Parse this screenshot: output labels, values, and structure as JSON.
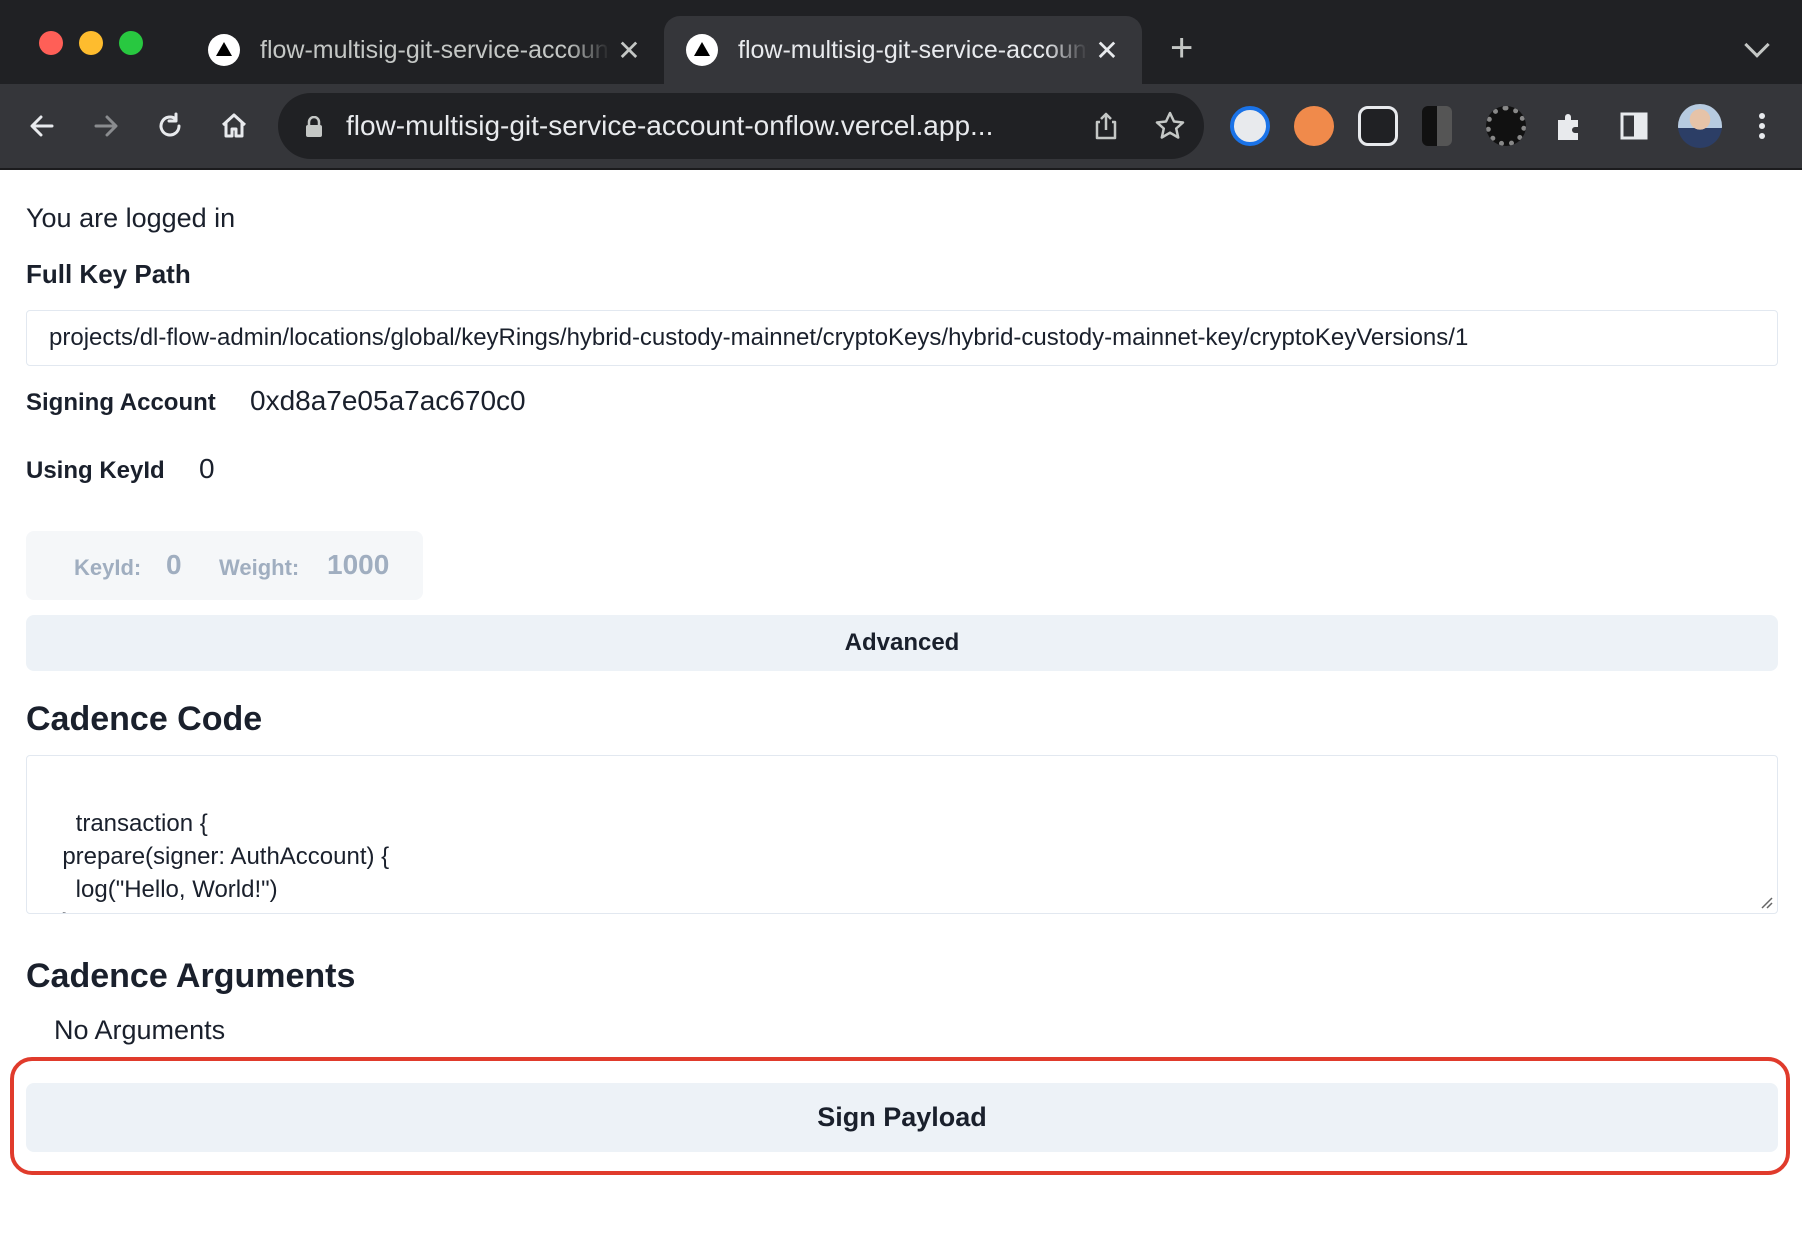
{
  "browser": {
    "tabs": [
      {
        "title": "flow-multisig-git-service-account-onflow",
        "active": false
      },
      {
        "title": "flow-multisig-git-service-account-onflow",
        "active": true
      }
    ],
    "new_tab_icon": "plus-icon",
    "url": "flow-multisig-git-service-account-onflow.vercel.app...",
    "extensions": [
      "password-manager-icon",
      "incognito-extension-icon",
      "glasses-extension-icon",
      "b-extension-icon",
      "sun-extension-icon",
      "puzzle-icon",
      "sidepanel-icon",
      "profile-avatar",
      "more-menu-icon"
    ]
  },
  "page": {
    "status": "You are logged in",
    "full_key_path_label": "Full Key Path",
    "full_key_path": "projects/dl-flow-admin/locations/global/keyRings/hybrid-custody-mainnet/cryptoKeys/hybrid-custody-mainnet-key/cryptoKeyVersions/1",
    "signing_account_label": "Signing Account",
    "signing_account": "0xd8a7e05a7ac670c0",
    "using_keyid_label": "Using KeyId",
    "using_keyid": "0",
    "key_card": {
      "keyid_label": "KeyId:",
      "keyid": "0",
      "weight_label": "Weight:",
      "weight": "1000"
    },
    "advanced_label": "Advanced",
    "cadence_code_title": "Cadence Code",
    "cadence_code": "transaction {\n  prepare(signer: AuthAccount) {\n    log(\"Hello, World!\")\n  }",
    "cadence_args_title": "Cadence Arguments",
    "no_args": "No Arguments",
    "sign_payload_label": "Sign Payload"
  },
  "colors": {
    "highlight": "#e03b2c",
    "button_bg": "#edf2f7"
  }
}
